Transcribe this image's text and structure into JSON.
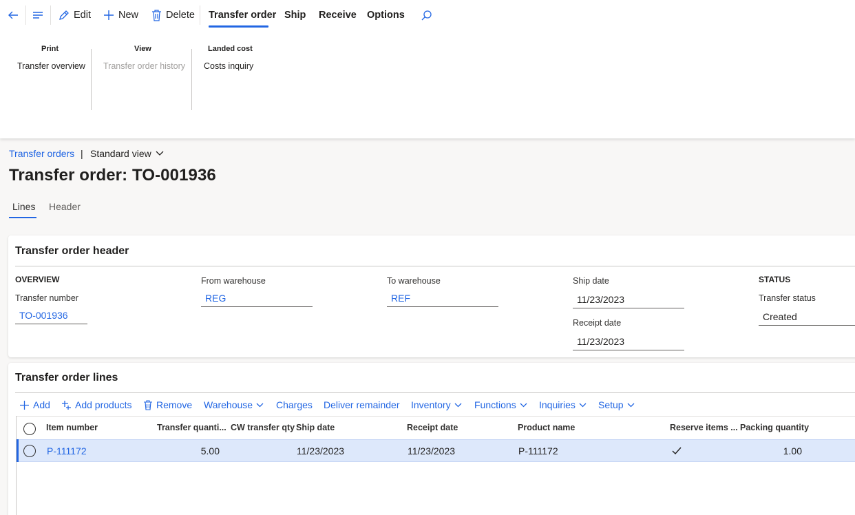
{
  "toolbar": {
    "edit": "Edit",
    "new": "New",
    "delete": "Delete",
    "tabs": [
      "Transfer order",
      "Ship",
      "Receive",
      "Options"
    ],
    "active_tab": "Transfer order"
  },
  "ribbon": {
    "groups": [
      {
        "title": "Print",
        "items": [
          "Transfer overview"
        ]
      },
      {
        "title": "View",
        "items": [
          "Transfer order history"
        ]
      },
      {
        "title": "Landed cost",
        "items": [
          "Costs inquiry"
        ]
      }
    ]
  },
  "breadcrumb": {
    "link": "Transfer orders",
    "separator": "|",
    "view": "Standard view"
  },
  "page": {
    "title": "Transfer order: TO-001936"
  },
  "page_tabs": [
    "Lines",
    "Header"
  ],
  "header_card": {
    "title": "Transfer order header",
    "overview_heading": "OVERVIEW",
    "transfer_number_label": "Transfer number",
    "transfer_number": "TO-001936",
    "from_warehouse_label": "From warehouse",
    "from_warehouse": "REG",
    "to_warehouse_label": "To warehouse",
    "to_warehouse": "REF",
    "ship_date_label": "Ship date",
    "ship_date": "11/23/2023",
    "receipt_date_label": "Receipt date",
    "receipt_date": "11/23/2023",
    "status_heading": "STATUS",
    "transfer_status_label": "Transfer status",
    "transfer_status": "Created"
  },
  "lines_card": {
    "title": "Transfer order lines",
    "toolbar": [
      "Add",
      "Add products",
      "Remove",
      "Warehouse",
      "Charges",
      "Deliver remainder",
      "Inventory",
      "Functions",
      "Inquiries",
      "Setup"
    ],
    "columns": [
      "Item number",
      "Transfer quanti...",
      "CW transfer qty",
      "Ship date",
      "Receipt date",
      "Product name",
      "Reserve items ...",
      "Packing quantity"
    ],
    "rows": [
      {
        "item_number": "P-111172",
        "transfer_quantity": "5.00",
        "cw_transfer_qty": "",
        "ship_date": "11/23/2023",
        "receipt_date": "11/23/2023",
        "product_name": "P-111172",
        "reserve_items": true,
        "packing_quantity": "1.00"
      }
    ]
  },
  "colors": {
    "accent": "#2266e3",
    "selected_row": "#dde8fb"
  }
}
